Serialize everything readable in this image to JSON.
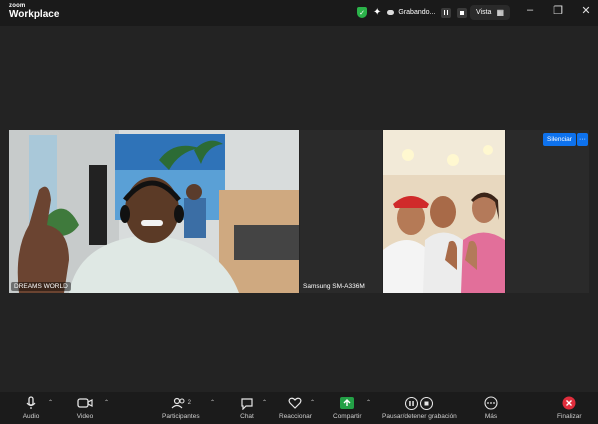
{
  "app": {
    "brand_top": "zoom",
    "brand_bottom": "Workplace"
  },
  "status": {
    "recording_label": "Grabando...",
    "view_label": "Vista"
  },
  "colors": {
    "accent": "#0e72ed",
    "shield": "#2bb34a",
    "end": "#e02d3c",
    "share": "#23a046"
  },
  "tiles": [
    {
      "name": "DREAMS WORLD"
    },
    {
      "name": "Samsung SM-A336M"
    }
  ],
  "tile_actions": {
    "mute_label": "Silenciar",
    "more_label": "···"
  },
  "toolbar": {
    "audio": "Audio",
    "video": "Video",
    "participants": "Participantes",
    "participants_count": "2",
    "chat": "Chat",
    "react": "Reaccionar",
    "share": "Compartir",
    "pause_record": "Pausar/detener grabación",
    "more": "Más",
    "end": "Finalizar"
  }
}
